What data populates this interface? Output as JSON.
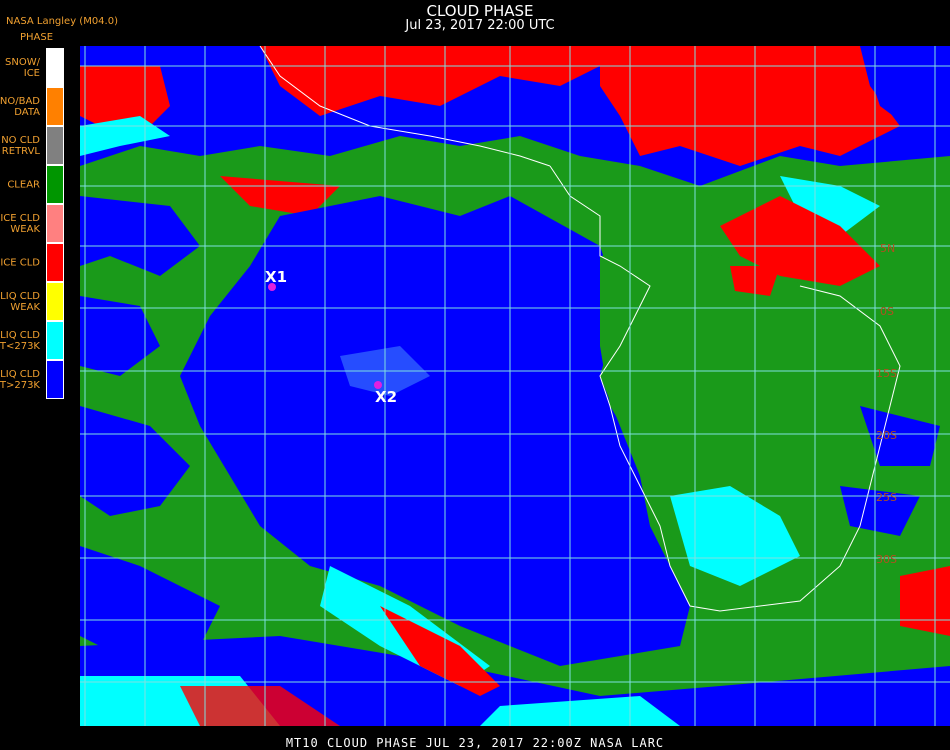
{
  "header": {
    "title": "CLOUD PHASE",
    "datetime": "Jul 23, 2017 22:00 UTC",
    "provider": "NASA Langley (M04.0)"
  },
  "legend": {
    "title": "PHASE",
    "items": [
      {
        "label": "SNOW/\nICE",
        "color": "#ffffff"
      },
      {
        "label": "NO/BAD\nDATA",
        "color": "#ff8000"
      },
      {
        "label": "NO CLD\nRETRVL",
        "color": "#808080"
      },
      {
        "label": "CLEAR",
        "color": "#009600"
      },
      {
        "label": "ICE CLD\nWEAK",
        "color": "#ff8080"
      },
      {
        "label": "ICE CLD",
        "color": "#ff0000"
      },
      {
        "label": "LIQ CLD\nWEAK",
        "color": "#ffff00"
      },
      {
        "label": "LIQ CLD\nT<273K",
        "color": "#00ffff"
      },
      {
        "label": "LIQ CLD\nT>273K",
        "color": "#0000ff"
      }
    ]
  },
  "map": {
    "markers": [
      {
        "label": "X1",
        "color": "#e020e0"
      },
      {
        "label": "X2",
        "color": "#e020e0"
      }
    ],
    "lat_labels": [
      "5N",
      "0S",
      "15S",
      "20S",
      "25S",
      "30S"
    ]
  },
  "footer": {
    "text": "MT10  CLOUD PHASE   JUL 23, 2017 22:00Z   NASA LARC"
  }
}
